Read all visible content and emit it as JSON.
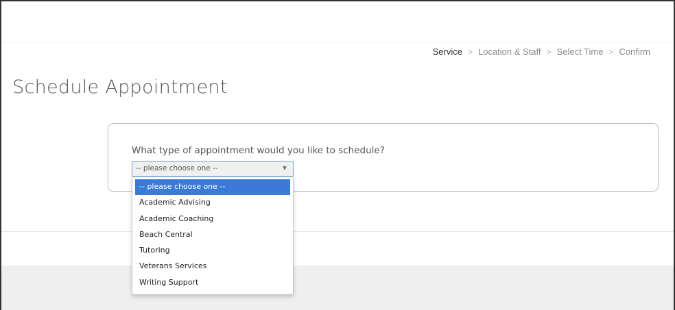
{
  "breadcrumb": {
    "steps": [
      "Service",
      "Location & Staff",
      "Select Time",
      "Confirm"
    ],
    "separator": ">",
    "active_index": 0
  },
  "page": {
    "title": "Schedule Appointment"
  },
  "form": {
    "question": "What type of appointment would you like to schedule?",
    "select_value": "-- please choose one --",
    "options": [
      "-- please choose one --",
      "Academic Advising",
      "Academic Coaching",
      "Beach Central",
      "Tutoring",
      "Veterans Services",
      "Writing Support"
    ],
    "highlighted_option_index": 0,
    "dropdown_open": true
  },
  "colors": {
    "highlight": "#3b7ad9",
    "select_border": "#6ea1d9",
    "footer_bg": "#efefef"
  }
}
